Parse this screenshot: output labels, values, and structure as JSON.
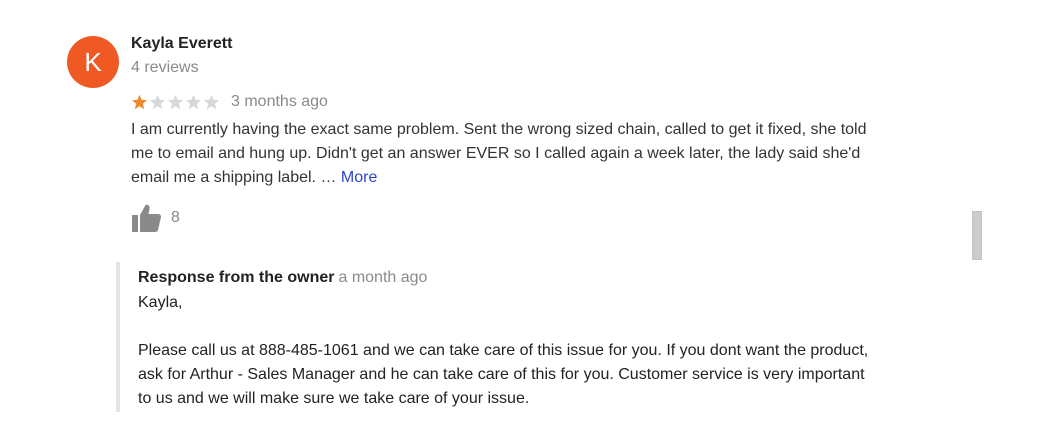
{
  "review": {
    "avatar_letter": "K",
    "avatar_color": "#ef5a24",
    "reviewer_name": "Kayla Everett",
    "review_count": "4 reviews",
    "rating": 1,
    "max_rating": 5,
    "star_filled_color": "#ef8a2e",
    "star_empty_color": "#d8d8d8",
    "date": "3 months ago",
    "text": "I am currently having the exact same problem. Sent the wrong sized chain, called to get it fixed,  she told\nme to email and hung up.  Didn't get an answer EVER so I called again a week later, the lady said she'd\nemail me a shipping label. … ",
    "more_label": "More",
    "like_icon": "thumbs-up-icon",
    "like_count": "8"
  },
  "owner_response": {
    "title": "Response from the owner",
    "date": "a month ago",
    "text": "Kayla,\n\nPlease call us at 888-485-1061 and we can take care of this issue for you. If you dont want the product,\nask for Arthur - Sales Manager and he can take care of this for you. Customer service is very important\nto us and we will make sure we take care of your issue."
  }
}
